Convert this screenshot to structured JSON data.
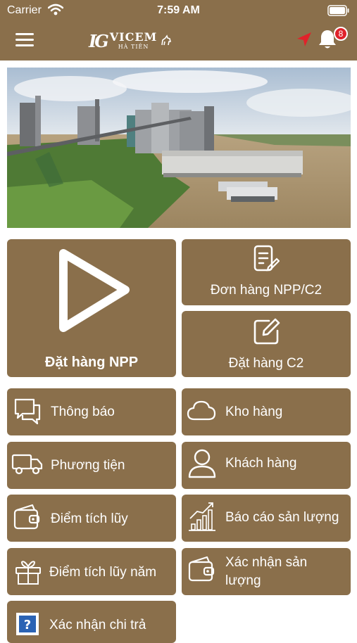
{
  "status_bar": {
    "carrier": "Carrier",
    "time": "7:59 AM"
  },
  "header": {
    "logo_mark": "IG",
    "logo_name": "VICEM",
    "logo_sub": "HÀ TIÊN",
    "notification_count": "8"
  },
  "colors": {
    "tile": "#8a6f4b",
    "header": "#8a6f4b",
    "badge": "#e0222a",
    "location": "#e0222a"
  },
  "menu": {
    "dat_hang_npp": "Đặt hàng NPP",
    "don_hang_npp_c2": "Đơn hàng NPP/C2",
    "dat_hang_c2": "Đặt hàng C2",
    "thong_bao": "Thông báo",
    "kho_hang": "Kho hàng",
    "phuong_tien": "Phương tiện",
    "khach_hang": "Khách hàng",
    "diem_tich_luy": "Điểm tích lũy",
    "bao_cao_san_luong": "Báo cáo sản lượng",
    "diem_tich_luy_nam": "Điểm tích lũy năm",
    "xac_nhan_san_luong": "Xác nhận sản lượng",
    "xac_nhan_chi_tra": "Xác nhận chi trả"
  },
  "icons": {
    "play": "play-icon",
    "order_list": "document-edit-icon",
    "edit": "edit-icon",
    "chat": "chat-icon",
    "cloud": "cloud-icon",
    "truck": "truck-icon",
    "user": "user-icon",
    "wallet": "wallet-icon",
    "chart": "bar-chart-icon",
    "gift": "gift-icon",
    "wallet2": "wallet-icon",
    "question": "question-icon"
  }
}
